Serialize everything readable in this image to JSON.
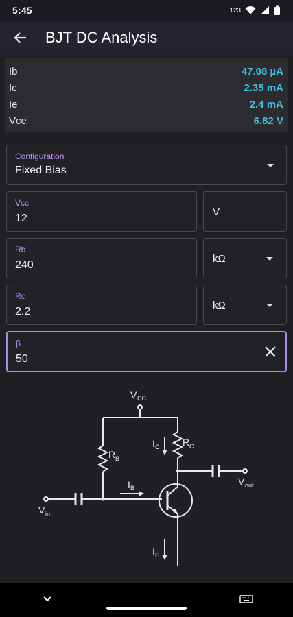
{
  "status": {
    "time": "5:45",
    "indicator": "123"
  },
  "appbar": {
    "title": "BJT DC Analysis"
  },
  "results": [
    {
      "label": "Ib",
      "value": "47.08 µA"
    },
    {
      "label": "Ic",
      "value": "2.35 mA"
    },
    {
      "label": "Ie",
      "value": "2.4 mA"
    },
    {
      "label": "Vce",
      "value": "6.82 V"
    }
  ],
  "config": {
    "label": "Configuration",
    "value": "Fixed Bias"
  },
  "vcc": {
    "label": "Vcc",
    "value": "12",
    "unit": "V"
  },
  "rb": {
    "label": "Rb",
    "value": "240",
    "unit": "kΩ"
  },
  "rc": {
    "label": "Rc",
    "value": "2.2",
    "unit": "kΩ"
  },
  "beta": {
    "label": "β",
    "value": "50"
  },
  "circuit": {
    "vcc": "V",
    "vcc_sub": "CC",
    "rb": "R",
    "rb_sub": "B",
    "rc": "R",
    "rc_sub": "C",
    "ic": "I",
    "ic_sub": "C",
    "ib": "I",
    "ib_sub": "B",
    "ie": "I",
    "ie_sub": "E",
    "vin": "V",
    "vin_sub": "in",
    "vout": "V",
    "vout_sub": "out"
  },
  "colors": {
    "accent": "#a98be6",
    "result": "#3fc0e4",
    "background": "#202024"
  }
}
